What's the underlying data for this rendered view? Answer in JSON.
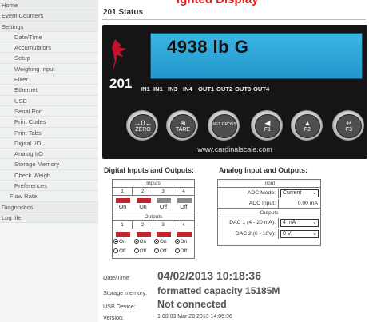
{
  "window": {
    "banner_title": "ighted Display",
    "page_title": "201 Status"
  },
  "sidebar": {
    "items": [
      {
        "label": "Home",
        "kind": "top"
      },
      {
        "label": "Event Counters",
        "kind": "top"
      },
      {
        "label": "Settings",
        "kind": "top"
      },
      {
        "label": "Date/Time",
        "kind": "sub"
      },
      {
        "label": "Accumulators",
        "kind": "sub"
      },
      {
        "label": "Setup",
        "kind": "sub"
      },
      {
        "label": "Weighing Input",
        "kind": "sub"
      },
      {
        "label": "Filter",
        "kind": "sub"
      },
      {
        "label": "Ethernet",
        "kind": "sub"
      },
      {
        "label": "USB",
        "kind": "sub"
      },
      {
        "label": "Serial Port",
        "kind": "sub"
      },
      {
        "label": "Print Codes",
        "kind": "sub"
      },
      {
        "label": "Print Tabs",
        "kind": "sub"
      },
      {
        "label": "Digital I/O",
        "kind": "sub"
      },
      {
        "label": "Analog I/O",
        "kind": "sub"
      },
      {
        "label": "Storage Memory",
        "kind": "sub"
      },
      {
        "label": "Check Weigh",
        "kind": "sub"
      },
      {
        "label": "Preferences",
        "kind": "sub"
      },
      {
        "label": "Flow Rate",
        "kind": "sub"
      },
      {
        "label": "Diagnostics",
        "kind": "top"
      },
      {
        "label": "Log file",
        "kind": "top"
      }
    ]
  },
  "indicator": {
    "model": "201",
    "weight": "4938 lb G",
    "annunciators": [
      "IN1",
      "IN1",
      "IN3",
      "IN4",
      "OUT1",
      "OUT2",
      "OUT3",
      "OUT4"
    ],
    "keys": [
      {
        "label": "ZERO",
        "symbol": "→0←",
        "icon": "zero-key-icon"
      },
      {
        "label": "TARE",
        "symbol": "⊕",
        "icon": "tare-key-icon"
      },
      {
        "label": "",
        "symbol": "NET GROSS",
        "icon": "net-gross-key-icon"
      },
      {
        "label": "F1",
        "symbol": "◀",
        "icon": "f1-key-icon"
      },
      {
        "label": "F2",
        "symbol": "▲",
        "icon": "f2-key-icon"
      },
      {
        "label": "F3",
        "symbol": "↵",
        "icon": "f3-key-icon"
      }
    ],
    "website": "www.cardinalscale.com",
    "colors": {
      "lcd": "#2aa6dc",
      "bezel": "#151515",
      "logo": "#c8102e"
    }
  },
  "digital_io": {
    "title": "Digital Inputs and Outputs:",
    "inputs_header": "Inputs",
    "outputs_header": "Outputs",
    "numbers": [
      "1",
      "2",
      "3",
      "4"
    ],
    "inputs": [
      {
        "state": "On",
        "color": "#c0262c"
      },
      {
        "state": "On",
        "color": "#c0262c"
      },
      {
        "state": "Off",
        "color": "#8a8a8a"
      },
      {
        "state": "Off",
        "color": "#8a8a8a"
      }
    ],
    "outputs": [
      {
        "color": "#c0262c",
        "selected": "On"
      },
      {
        "color": "#c0262c",
        "selected": "On"
      },
      {
        "color": "#c0262c",
        "selected": "On"
      },
      {
        "color": "#c0262c",
        "selected": "On"
      }
    ],
    "on_label": "On",
    "off_label": "Off"
  },
  "analog_io": {
    "title": "Analog Input and Outputs:",
    "input_header": "Input",
    "outputs_header": "Outputs",
    "adc_mode_label": "ADC Mode:",
    "adc_mode_value": "Current",
    "adc_input_label": "ADC Input:",
    "adc_input_value": "0.00 mA",
    "dac1_label": "DAC 1 (4 - 20 mA):",
    "dac1_value": "4 mA",
    "dac2_label": "DAC 2 (0 - 10V):",
    "dac2_value": "0 V"
  },
  "status": {
    "date_label": "Date/Time",
    "date_value": "04/02/2013 10:18:36",
    "storage_label": "Storage memory:",
    "storage_value": "formatted capacity 15185M",
    "usb_label": "USB Device:",
    "usb_value": "Not connected",
    "version_label": "Version:",
    "version_value": "1.00.03 Mar 28 2013 14:05:36"
  }
}
